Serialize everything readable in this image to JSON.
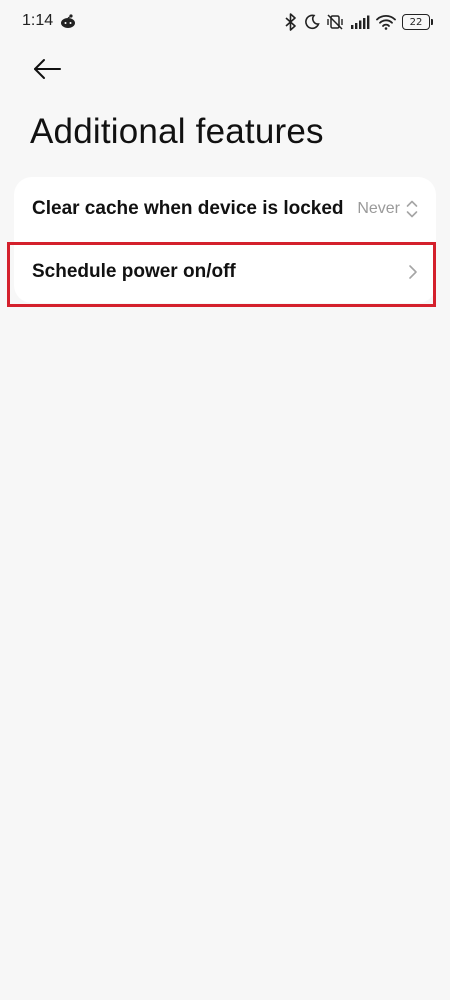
{
  "status_bar": {
    "time": "1:14",
    "battery_level": "22",
    "icons": [
      "app-notification-icon",
      "bluetooth-icon",
      "do-not-disturb-icon",
      "vibrate-off-icon",
      "signal-icon",
      "wifi-icon",
      "battery-icon"
    ]
  },
  "header": {
    "back_icon": "back-arrow-icon",
    "title": "Additional features"
  },
  "settings": {
    "items": [
      {
        "label": "Clear cache when device is locked",
        "value": "Never",
        "icon": "up-down-chevron-icon"
      },
      {
        "label": "Schedule power on/off",
        "icon": "chevron-right-icon",
        "highlighted": true
      }
    ]
  },
  "colors": {
    "background": "#f7f7f7",
    "card": "#ffffff",
    "highlight": "#d4202c",
    "secondary_text": "#9a9a9a"
  }
}
